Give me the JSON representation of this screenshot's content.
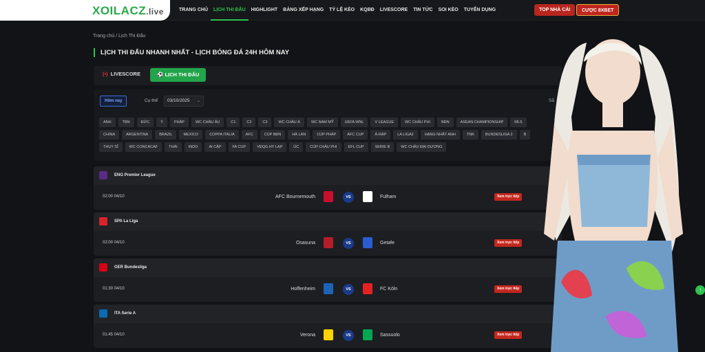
{
  "brand": {
    "logo_main": "XOILACZ",
    "logo_suffix": ".live"
  },
  "nav": [
    "TRANG CHỦ",
    "LỊCH THI ĐẤU",
    "HIGHLIGHT",
    "BẢNG XẾP HẠNG",
    "TỶ LỆ KÈO",
    "KQBĐ",
    "LIVESCORE",
    "TIN TỨC",
    "SOI KÈO",
    "TUYỂN DỤNG"
  ],
  "top_buttons": {
    "top_nha_cai": "TOP NHÀ CÁI",
    "cuoc": "CƯỢC 8XBET"
  },
  "breadcrumb": "Trang chủ  /  Lịch Thi Đấu",
  "page_title": "LỊCH THI ĐẤU NHANH NHẤT - LỊCH BÓNG ĐÁ 24H HÔM NAY",
  "tabs": {
    "livescore": "LIVESCORE",
    "schedule": "LỊCH THI ĐẤU"
  },
  "filters": {
    "today": "Hôm nay",
    "date_label": "Cụ thể",
    "date_value": "03/10/2025",
    "sort_text": "Sắ"
  },
  "chips": [
    [
      "ANH",
      "TBN",
      "ĐỨC",
      "Ý",
      "PHÁP",
      "WC CHÂU ÂU",
      "C1",
      "C2",
      "C3",
      "WC CHÂU Á",
      "WC NAM MỸ",
      "UEFA WNL",
      "V LEAGUE",
      "WC CHÂU PHI",
      "BĐN",
      "ASEAN CHAMPIONSHIP",
      "MLS"
    ],
    [
      "CHINA",
      "ARGENTINA",
      "BRAZIL",
      "MEXICO",
      "COPPA ITALIA",
      "AFC",
      "CÚP BĐN",
      "HÀ LAN",
      "CÚP PHÁP",
      "AFC CUP",
      "Ả-RẬP",
      "LA LIGA2",
      "HẠNG NHẤT ANH",
      "TNK",
      "BUNDESLIGA 2",
      "B"
    ],
    [
      "THỤY SĨ",
      "WC CONCACAF",
      "THÁI",
      "INDO",
      "AI CẬP",
      "FA CUP",
      "VĐQG HY LẠP",
      "ÚC",
      "CÚP CHÂU PHI",
      "EFL CUP",
      "SERIE B",
      "WC CHÂU ĐẠI DƯƠNG"
    ]
  ],
  "leagues": [
    {
      "name": "ENG Premier League",
      "time": "02:00 04/10",
      "home": "AFC Bournemouth",
      "away": "Fulham",
      "icon_color": "#5a2b86",
      "home_color": "#c8102e",
      "away_color": "#ffffff"
    },
    {
      "name": "SPA La Liga",
      "time": "02:00 04/10",
      "home": "Osasuna",
      "away": "Getafe",
      "icon_color": "#d8232a",
      "home_color": "#b61d2a",
      "away_color": "#2a5ccf"
    },
    {
      "name": "GER Bundesliga",
      "time": "01:30 04/10",
      "home": "Hoffenheim",
      "away": "FC Köln",
      "icon_color": "#d20515",
      "home_color": "#1c63b7",
      "away_color": "#e32221"
    },
    {
      "name": "ITA Serie A",
      "time": "01:45 04/10",
      "home": "Verona",
      "away": "Sassuolo",
      "icon_color": "#0a6ab3",
      "home_color": "#ffd200",
      "away_color": "#00a752"
    }
  ],
  "vs_label": "VS",
  "watch_label": "Xem trực tiếp",
  "scroll_top": "↑"
}
